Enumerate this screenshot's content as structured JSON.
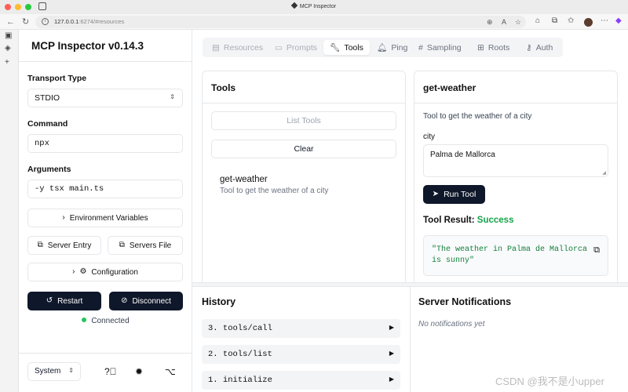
{
  "browser": {
    "window_title": "MCP Inspector",
    "url_host": "127.0.0.1",
    "url_rest": ":6274/#resources"
  },
  "sidebar": {
    "app_title": "MCP Inspector v0.14.3",
    "transport_label": "Transport Type",
    "transport_value": "STDIO",
    "command_label": "Command",
    "command_value": "npx",
    "arguments_label": "Arguments",
    "arguments_value": "-y tsx main.ts",
    "env_vars_label": "Environment Variables",
    "server_entry_label": "Server Entry",
    "servers_file_label": "Servers File",
    "configuration_label": "Configuration",
    "restart_label": "Restart",
    "disconnect_label": "Disconnect",
    "status_text": "Connected",
    "status_color": "#22c55e",
    "theme_value": "System"
  },
  "tabs": [
    {
      "label": "Resources",
      "icon": "resources-icon",
      "state": "disabled"
    },
    {
      "label": "Prompts",
      "icon": "prompts-icon",
      "state": "disabled"
    },
    {
      "label": "Tools",
      "icon": "wrench-icon",
      "state": "active"
    },
    {
      "label": "Ping",
      "icon": "bell-icon",
      "state": "normal"
    },
    {
      "label": "Sampling",
      "icon": "hash-icon",
      "state": "normal"
    },
    {
      "label": "Roots",
      "icon": "roots-icon",
      "state": "normal"
    },
    {
      "label": "Auth",
      "icon": "key-icon",
      "state": "normal"
    }
  ],
  "tools_panel": {
    "title": "Tools",
    "list_tools_label": "List Tools",
    "clear_label": "Clear",
    "items": [
      {
        "name": "get-weather",
        "description": "Tool to get the weather of a city"
      }
    ]
  },
  "tool_detail": {
    "title": "get-weather",
    "description": "Tool to get the weather of a city",
    "param_label": "city",
    "param_value": "Palma de Mallorca",
    "run_label": "Run Tool",
    "result_label": "Tool Result:",
    "result_status": "Success",
    "result_text": "\"The weather in Palma de Mallorca is sunny\""
  },
  "history": {
    "title": "History",
    "items": [
      "3. tools/call",
      "2. tools/list",
      "1. initialize"
    ]
  },
  "notifications": {
    "title": "Server Notifications",
    "empty_text": "No notifications yet"
  },
  "watermark": "CSDN @我不是小upper"
}
